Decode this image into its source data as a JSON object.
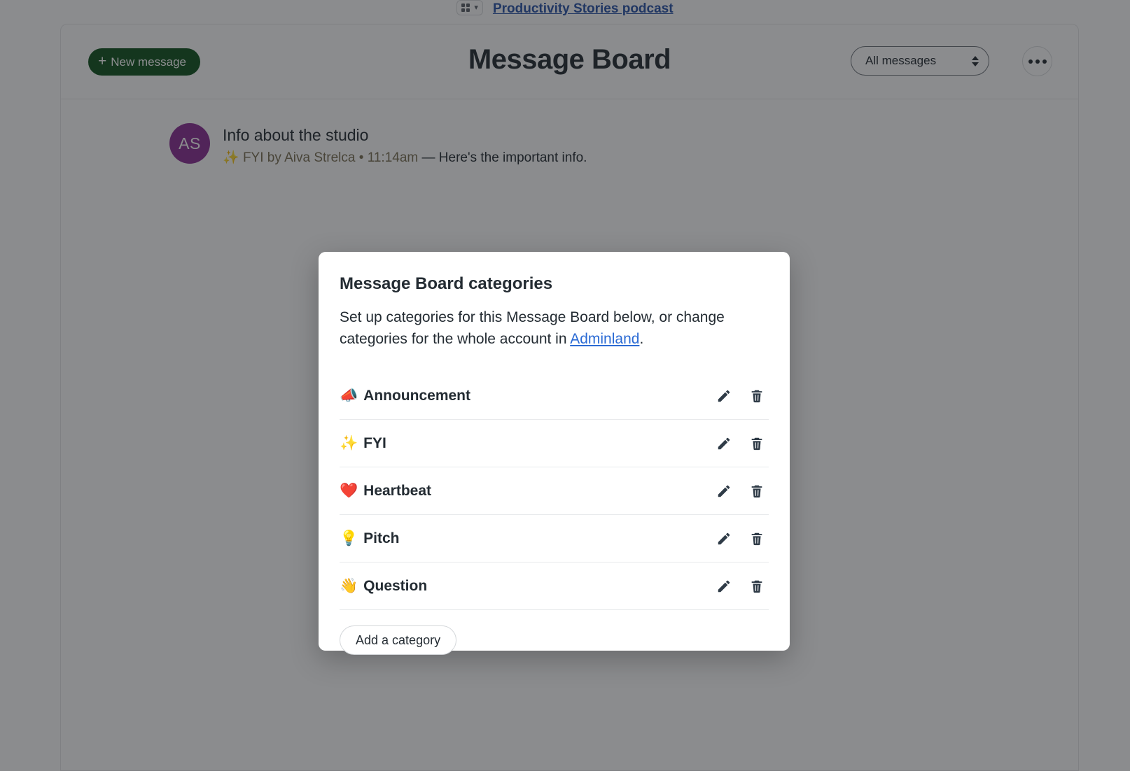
{
  "topbar": {
    "grid_icon": "grid-icon",
    "chevron_icon": "chevron-down-icon",
    "breadcrumb": "Productivity Stories podcast"
  },
  "board": {
    "new_message_label": "New message",
    "plus_icon": "plus-icon",
    "title": "Message Board",
    "filter_value": "All messages",
    "filter_icon": "stepper-icon",
    "more_icon": "ellipsis-icon"
  },
  "message": {
    "avatar_initials": "AS",
    "title": "Info about the studio",
    "category_emoji": "✨",
    "category": "FYI",
    "byline": "by Aiva Strelca",
    "separator": "•",
    "time": "11:14am",
    "dash": "—",
    "excerpt": "Here's the important info."
  },
  "modal": {
    "title": "Message Board categories",
    "description_before": "Set up categories for this Message Board below, or change categories for the whole account in ",
    "description_link": "Adminland",
    "description_after": ".",
    "edit_icon": "pencil-icon",
    "delete_icon": "trash-icon",
    "add_button_label": "Add a category",
    "categories": [
      {
        "emoji": "📣",
        "label": "Announcement"
      },
      {
        "emoji": "✨",
        "label": "FYI"
      },
      {
        "emoji": "❤️",
        "label": "Heartbeat"
      },
      {
        "emoji": "💡",
        "label": "Pitch"
      },
      {
        "emoji": "👋",
        "label": "Question"
      }
    ]
  },
  "colors": {
    "brand_green": "#10521f",
    "avatar_purple": "#8a2f94",
    "link_blue": "#2a6ad4",
    "breadcrumb_blue": "#2a55a8",
    "text_dark": "#242c33"
  }
}
